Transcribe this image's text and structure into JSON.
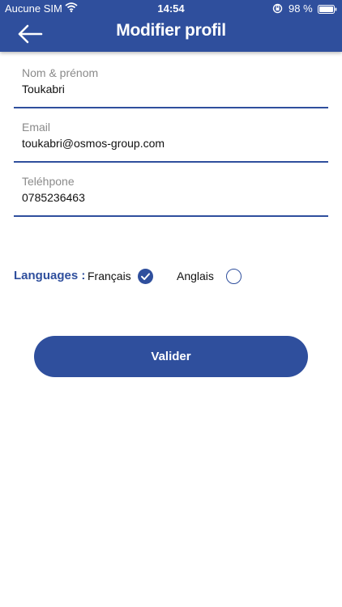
{
  "status_bar": {
    "carrier": "Aucune SIM",
    "time": "14:54",
    "battery": "98 %"
  },
  "header": {
    "title": "Modifier profil",
    "back_icon": "arrow-left-icon",
    "background": "#2f4f9d"
  },
  "form": {
    "name": {
      "label": "Nom & prénom",
      "value": "Toukabri"
    },
    "email": {
      "label": "Email",
      "value": "toukabri@osmos-group.com"
    },
    "phone": {
      "label": "Teléhpone",
      "value": "0785236463"
    }
  },
  "languages": {
    "label": "Languages :",
    "options": [
      {
        "label": "Français",
        "selected": true
      },
      {
        "label": "Anglais",
        "selected": false
      }
    ]
  },
  "submit": {
    "label": "Valider"
  },
  "colors": {
    "accent": "#2f4f9d",
    "label_gray": "#8a8a8a"
  }
}
